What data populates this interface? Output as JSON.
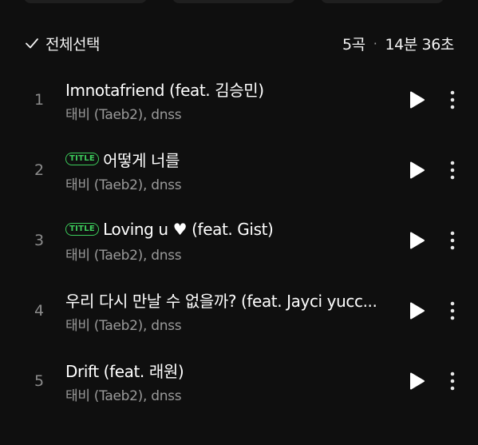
{
  "header": {
    "select_all_label": "전체선택",
    "track_count": "5곡",
    "separator": "·",
    "total_duration": "14분 36초"
  },
  "tracks": [
    {
      "number": "1",
      "badge": "",
      "title": "Imnotafriend (feat. 김승민)",
      "artist": "태비 (Taeb2), dnss"
    },
    {
      "number": "2",
      "badge": "TITLE",
      "title": "어떻게 너를",
      "artist": "태비 (Taeb2), dnss"
    },
    {
      "number": "3",
      "badge": "TITLE",
      "title": "Loving u ♥ (feat. Gist)",
      "artist": "태비 (Taeb2), dnss"
    },
    {
      "number": "4",
      "badge": "",
      "title": "우리 다시 만날 수 없을까? (feat. Jayci yucc...",
      "artist": "태비 (Taeb2), dnss"
    },
    {
      "number": "5",
      "badge": "",
      "title": "Drift (feat. 래원)",
      "artist": "태비 (Taeb2), dnss"
    }
  ],
  "icons": {
    "check": "check-icon",
    "play": "play-icon",
    "more": "more-vertical-icon"
  },
  "colors": {
    "background": "#0f0f0f",
    "title_badge": "#3ccb5b",
    "primary_text": "#ffffff",
    "secondary_text": "#9a9a9a"
  }
}
